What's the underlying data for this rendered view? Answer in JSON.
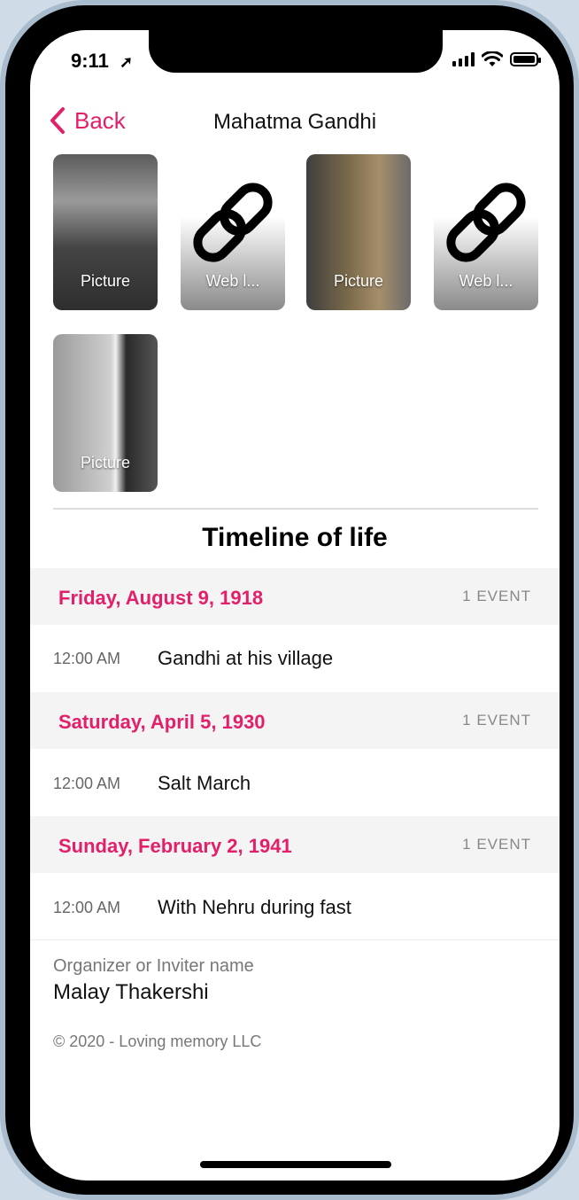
{
  "status_bar": {
    "time": "9:11"
  },
  "nav": {
    "back_label": "Back",
    "title": "Mahatma Gandhi"
  },
  "media": [
    {
      "type": "picture",
      "label": "Picture"
    },
    {
      "type": "web-link",
      "label": "Web l..."
    },
    {
      "type": "picture",
      "label": "Picture"
    },
    {
      "type": "web-link",
      "label": "Web l..."
    },
    {
      "type": "picture",
      "label": "Picture"
    }
  ],
  "timeline": {
    "title": "Timeline of life",
    "sections": [
      {
        "date": "Friday, August 9, 1918",
        "count": "1 EVENT",
        "events": [
          {
            "time": "12:00 AM",
            "title": "Gandhi at his village"
          }
        ]
      },
      {
        "date": "Saturday, April 5, 1930",
        "count": "1 EVENT",
        "events": [
          {
            "time": "12:00 AM",
            "title": "Salt March"
          }
        ]
      },
      {
        "date": "Sunday, February 2, 1941",
        "count": "1 EVENT",
        "events": [
          {
            "time": "12:00 AM",
            "title": "With Nehru during fast"
          }
        ]
      }
    ]
  },
  "organizer": {
    "label": "Organizer or Inviter name",
    "name": "Malay Thakershi"
  },
  "footer": {
    "copyright": "© 2020 - Loving memory LLC"
  },
  "colors": {
    "accent": "#e2206a",
    "section_bg": "#f4f4f4"
  },
  "icons": {
    "back": "chevron-left-icon",
    "link": "chain-link-icon"
  }
}
